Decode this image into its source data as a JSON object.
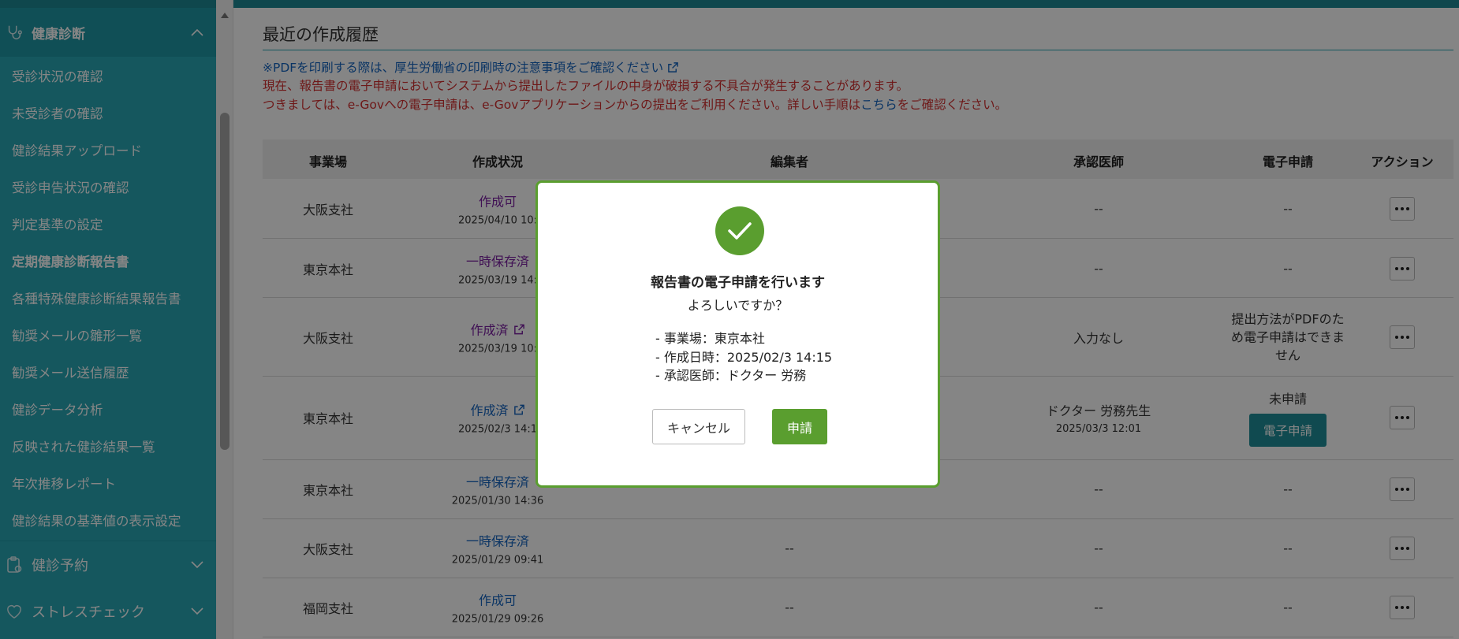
{
  "sidebar": {
    "health_section": "健康診断",
    "items": [
      {
        "label": "受診状況の確認"
      },
      {
        "label": "未受診者の確認"
      },
      {
        "label": "健診結果アップロード"
      },
      {
        "label": "受診申告状況の確認"
      },
      {
        "label": "判定基準の設定"
      },
      {
        "label": "定期健康診断報告書",
        "active": true
      },
      {
        "label": "各種特殊健康診断結果報告書"
      },
      {
        "label": "勧奨メールの雛形一覧"
      },
      {
        "label": "勧奨メール送信履歴"
      },
      {
        "label": "健診データ分析"
      },
      {
        "label": "反映された健診結果一覧"
      },
      {
        "label": "年次推移レポート"
      },
      {
        "label": "健診結果の基準値の表示設定"
      }
    ],
    "reservation_section": "健診予約",
    "stress_section": "ストレスチェック"
  },
  "main": {
    "title": "最近の作成履歴",
    "notice_pdf": "※PDFを印刷する際は、厚生労働省の印刷時の注意事項をご確認ください",
    "notice_red1": "現在、報告書の電子申請においてシステムから提出したファイルの中身が破損する不具合が発生することがあります。",
    "notice_red2_a": "つきましては、e-Govへの電子申請は、e-Govアプリケーションからの提出をご利用ください。詳しい手順は",
    "notice_red2_link": "こちら",
    "notice_red2_b": "をご確認ください。"
  },
  "table": {
    "headers": {
      "site": "事業場",
      "status": "作成状況",
      "editor": "編集者",
      "doctor": "承認医師",
      "egov": "電子申請",
      "action": "アクション"
    },
    "rows": [
      {
        "site": "大阪支社",
        "status": "作成可",
        "date": "2025/04/10 10:",
        "editor": "",
        "doctor": "--",
        "egov": "--"
      },
      {
        "site": "東京本社",
        "status": "一時保存済",
        "date": "2025/03/19 14:",
        "editor": "",
        "doctor": "--",
        "egov": "--"
      },
      {
        "site": "大阪支社",
        "status": "作成済",
        "date": "2025/03/19 10:",
        "editor": "",
        "doctor": "入力なし",
        "egov": "提出方法がPDFのため電子申請はできません"
      },
      {
        "site": "東京本社",
        "status": "作成済",
        "date": "2025/02/3 14:1",
        "editor": "",
        "doctor": "ドクター 労務先生",
        "doctor_date": "2025/03/3 12:01",
        "egov": "未申請",
        "egov_button": "電子申請"
      },
      {
        "site": "東京本社",
        "status": "一時保存済",
        "date": "2025/01/30 14:36",
        "editor": "",
        "doctor": "--",
        "egov": "--"
      },
      {
        "site": "大阪支社",
        "status": "一時保存済",
        "date": "2025/01/29 09:41",
        "editor": "--",
        "doctor": "--",
        "egov": "--"
      },
      {
        "site": "福岡支社",
        "status": "作成可",
        "date": "2025/01/29 09:26",
        "editor": "--",
        "doctor": "--",
        "egov": "--"
      }
    ]
  },
  "modal": {
    "title": "報告書の電子申請を行います",
    "subtitle": "よろしいですか？",
    "detail_site": "-  事業場：東京本社",
    "detail_date": "-  作成日時：2025/02/3 14:15",
    "detail_doctor": "-  承認医師：ドクター 労務",
    "cancel_label": "キャンセル",
    "apply_label": "申請"
  },
  "colors": {
    "sidebar_bg": "#2aa7b4",
    "accent_green": "#5a9e2f",
    "link_blue": "#1565c0",
    "warning_red": "#d32f2f",
    "egov_button": "#1f8f99"
  },
  "icons": {
    "health": "stethoscope-icon",
    "reservation": "clipboard-icon",
    "stress": "heart-icon",
    "external": "external-link-icon",
    "check": "check-icon",
    "more": "ellipsis-icon"
  }
}
